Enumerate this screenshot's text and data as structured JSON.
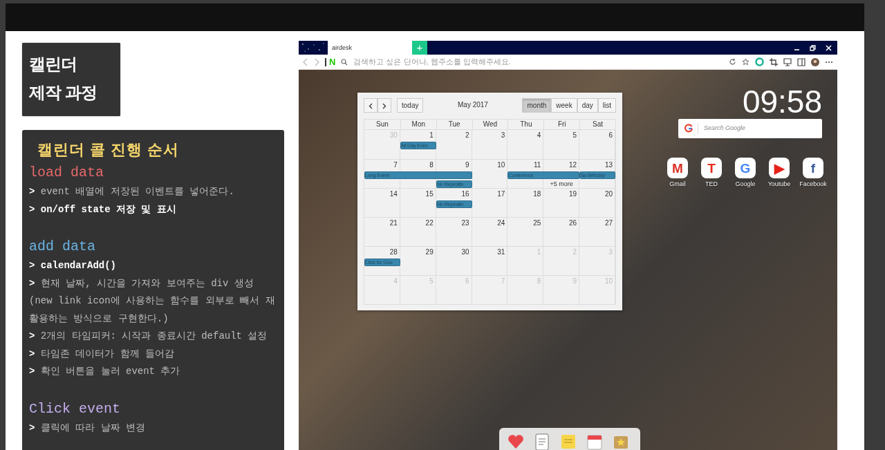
{
  "slide_title": {
    "lines": [
      "캘린더",
      "제작 과정"
    ]
  },
  "notes": {
    "heading": "캘린더 콜 진행 순서",
    "sections": [
      {
        "title": "load data",
        "color": "#e8686a",
        "lines": [
          {
            "text": "**>** event 배열에 저장된 이벤트를 넣어준다.",
            "emphasis": false
          },
          {
            "text": "> on/off state 저장 및 표시",
            "emphasis": true
          }
        ]
      },
      {
        "title": "add data",
        "color": "#6ab4e6",
        "lines": [
          {
            "text": "> calendarAdd()",
            "emphasis": true
          },
          {
            "text": "**>** 현재 날짜, 시간을 가져와 보여주는 div 생성",
            "emphasis": false
          },
          {
            "text": "(new link icon에 사용하는 함수를 외부로 빼서 재활용하는 방식으로 구현한다.)",
            "emphasis": false
          },
          {
            "text": "**>** 2개의 타임피커: 시작과 종료시간 default 설정",
            "emphasis": false
          },
          {
            "text": "**>** 타임존 데이터가 함께 들어감",
            "emphasis": false
          },
          {
            "text": "**>** 확인 버튼을 눌러 event 추가",
            "emphasis": false
          }
        ]
      },
      {
        "title": "Click event",
        "color": "#c3aef0",
        "lines": [
          {
            "text": "**>** 클릭에 따라 날짜 변경",
            "emphasis": false
          }
        ]
      }
    ]
  },
  "browser": {
    "tab": {
      "title": "airdesk",
      "selected": true
    },
    "new_tab": "+",
    "logo": "N",
    "address": {
      "placeholder": "검색하고 싶은 단어나, 웹주소를 입력해주세요."
    }
  },
  "newtab": {
    "clock": "09:58",
    "search": {
      "placeholder": "Search Google"
    },
    "shortcuts": [
      {
        "label": "Gmail",
        "glyph": "M",
        "color": "#d93025"
      },
      {
        "label": "TED",
        "glyph": "T",
        "color": "#e62b1e"
      },
      {
        "label": "Google",
        "glyph": "G",
        "color": "#4285f4"
      },
      {
        "label": "Youtube",
        "glyph": "▶",
        "color": "#e62117"
      },
      {
        "label": "Facebook",
        "glyph": "f",
        "color": "#3b5998"
      }
    ]
  },
  "calendar": {
    "title": "May 2017",
    "today": "today",
    "views": [
      {
        "label": "month",
        "selected": true
      },
      {
        "label": "week",
        "selected": false
      },
      {
        "label": "day",
        "selected": false
      },
      {
        "label": "list",
        "selected": false
      }
    ],
    "weekdays": [
      "Sun",
      "Mon",
      "Tue",
      "Wed",
      "Thu",
      "Fri",
      "Sat"
    ],
    "weeks": [
      {
        "days": [
          {
            "date": "30",
            "other_month": true
          },
          {
            "date": "1",
            "other_month": false
          },
          {
            "date": "2",
            "other_month": false
          },
          {
            "date": "3",
            "other_month": false
          },
          {
            "date": "4",
            "other_month": false
          },
          {
            "date": "5",
            "other_month": false
          },
          {
            "date": "6",
            "other_month": false
          }
        ],
        "lanes": [
          [
            {
              "kind": "blank"
            },
            {
              "kind": "event",
              "label": "All Day Even"
            }
          ]
        ]
      },
      {
        "days": [
          {
            "date": "7",
            "other_month": false
          },
          {
            "date": "8",
            "other_month": false
          },
          {
            "date": "9",
            "other_month": false
          },
          {
            "date": "10",
            "other_month": false
          },
          {
            "date": "11",
            "other_month": false
          },
          {
            "date": "12",
            "other_month": false
          },
          {
            "date": "13",
            "other_month": false
          }
        ],
        "lanes": [
          [
            {
              "kind": "event",
              "label": "Long Event"
            },
            {
              "kind": "cont"
            },
            {
              "kind": "cont"
            },
            {
              "kind": "blank"
            },
            {
              "kind": "event",
              "label": "Conference"
            },
            {
              "kind": "cont"
            },
            {
              "kind": "event",
              "label": "Sa Birthday"
            }
          ],
          [
            {
              "kind": "blank"
            },
            {
              "kind": "blank"
            },
            {
              "kind": "event",
              "label": "No Repeatin"
            },
            {
              "kind": "blank"
            },
            {
              "kind": "blank"
            },
            {
              "kind": "more",
              "label": "+5 more"
            }
          ]
        ]
      },
      {
        "days": [
          {
            "date": "14",
            "other_month": false
          },
          {
            "date": "15",
            "other_month": false
          },
          {
            "date": "16",
            "other_month": false
          },
          {
            "date": "17",
            "other_month": false
          },
          {
            "date": "18",
            "other_month": false
          },
          {
            "date": "19",
            "other_month": false
          },
          {
            "date": "20",
            "other_month": false
          }
        ],
        "lanes": [
          [
            {
              "kind": "blank"
            },
            {
              "kind": "blank"
            },
            {
              "kind": "event",
              "label": "No Repeatin"
            }
          ]
        ]
      },
      {
        "days": [
          {
            "date": "21",
            "other_month": false
          },
          {
            "date": "22",
            "other_month": false
          },
          {
            "date": "23",
            "other_month": false
          },
          {
            "date": "24",
            "other_month": false
          },
          {
            "date": "25",
            "other_month": false
          },
          {
            "date": "26",
            "other_month": false
          },
          {
            "date": "27",
            "other_month": false
          }
        ]
      },
      {
        "days": [
          {
            "date": "28",
            "other_month": false
          },
          {
            "date": "29",
            "other_month": false
          },
          {
            "date": "30",
            "other_month": false
          },
          {
            "date": "31",
            "other_month": false
          },
          {
            "date": "1",
            "other_month": true
          },
          {
            "date": "2",
            "other_month": true
          },
          {
            "date": "3",
            "other_month": true
          }
        ],
        "lanes": [
          [
            {
              "kind": "event",
              "label": "Click for Goo"
            }
          ]
        ]
      },
      {
        "days": [
          {
            "date": "4",
            "other_month": true
          },
          {
            "date": "5",
            "other_month": true
          },
          {
            "date": "6",
            "other_month": true
          },
          {
            "date": "7",
            "other_month": true
          },
          {
            "date": "8",
            "other_month": true
          },
          {
            "date": "9",
            "other_month": true
          },
          {
            "date": "10",
            "other_month": true
          }
        ]
      }
    ]
  }
}
